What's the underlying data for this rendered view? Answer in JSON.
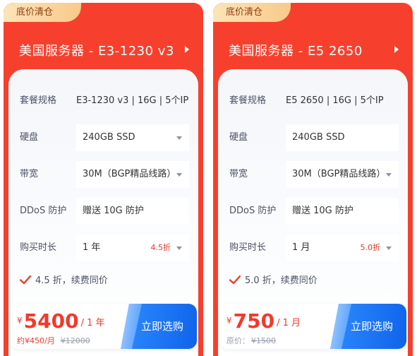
{
  "colors": {
    "card_red": "#f6402d",
    "price_red": "#f2392b",
    "button_blue": "#1a73f0",
    "label_gray": "#4a5266"
  },
  "cards": [
    {
      "tag": "底价清仓",
      "title": "美国服务器 - E3-1230 v3",
      "spec_label": "套餐规格",
      "spec_value": "E3-1230 v3 | 16G | 5个IP",
      "disk_label": "硬盘",
      "disk_value": "240GB SSD",
      "bandwidth_label": "带宽",
      "bandwidth_value": "30M（BGP精品线路）",
      "ddos_label": "DDoS 防护",
      "ddos_value": "赠送 10G 防护",
      "duration_label": "购买时长",
      "duration_value": "1 年",
      "duration_discount": "4.5折",
      "promo": "4.5 折，续费同价",
      "price_currency": "¥",
      "price_amount": "5400",
      "price_unit": "/ 1 年",
      "monthly": "约¥450/月",
      "original_price": "¥12000",
      "buy_label": "立即选购"
    },
    {
      "tag": "底价清仓",
      "title": "美国服务器 - E5 2650",
      "spec_label": "套餐规格",
      "spec_value": "E5 2650 | 16G | 5个IP",
      "disk_label": "硬盘",
      "disk_value": "240GB SSD",
      "bandwidth_label": "带宽",
      "bandwidth_value": "30M（BGP精品线路）",
      "ddos_label": "DDoS 防护",
      "ddos_value": "赠送 10G 防护",
      "duration_label": "购买时长",
      "duration_value": "1 月",
      "duration_discount": "5.0折",
      "promo": "5.0 折，续费同价",
      "price_currency": "¥",
      "price_amount": "750",
      "price_unit": "/ 1 月",
      "monthly": "原价：",
      "original_price": "¥1500",
      "buy_label": "立即选购"
    }
  ]
}
